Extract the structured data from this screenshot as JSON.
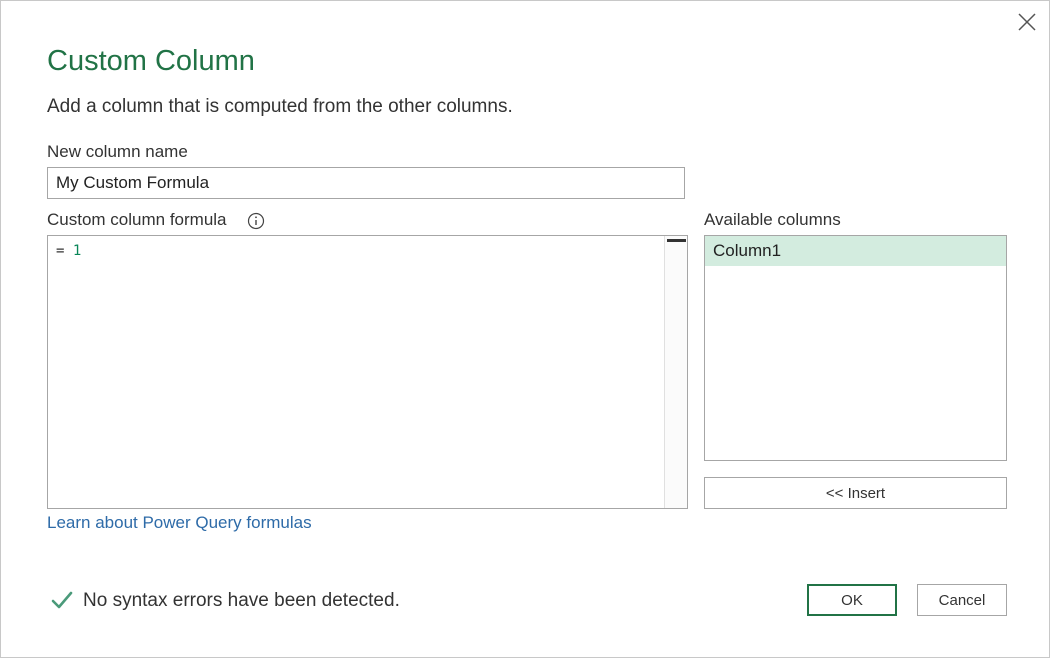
{
  "dialog": {
    "title": "Custom Column",
    "subtitle": "Add a column that is computed from the other columns.",
    "close_icon": "close-icon"
  },
  "new_column": {
    "label": "New column name",
    "value": "My Custom Formula"
  },
  "formula": {
    "label": "Custom column formula",
    "info_icon": "info-icon",
    "prefix": "= ",
    "value": "1"
  },
  "available_columns": {
    "label": "Available columns",
    "items": [
      "Column1"
    ],
    "selected_index": 0,
    "insert_label": "<< Insert"
  },
  "learn_link": "Learn about Power Query formulas",
  "status": {
    "icon": "checkmark-icon",
    "text": "No syntax errors have been detected."
  },
  "buttons": {
    "ok": "OK",
    "cancel": "Cancel"
  },
  "colors": {
    "accent": "#217346",
    "selected_row": "#d3ecdf",
    "link": "#2e6ba8",
    "check": "#4a9a7a"
  }
}
